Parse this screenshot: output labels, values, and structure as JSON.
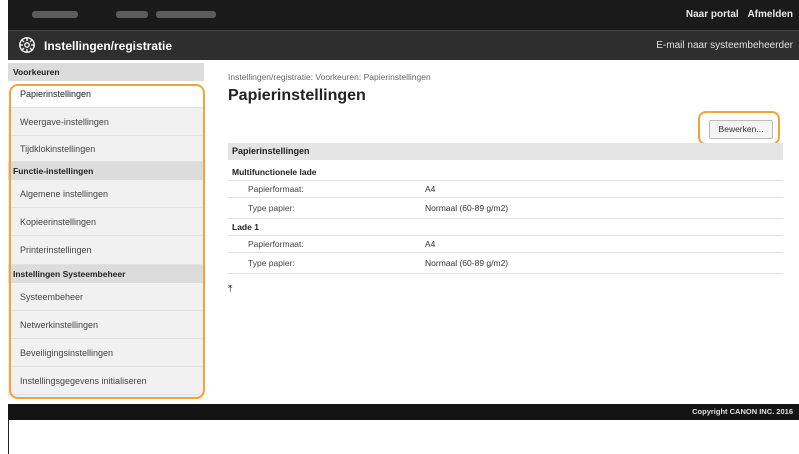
{
  "header": {
    "links": [
      "Naar portal",
      "Afmelden"
    ],
    "title": "Instellingen/registratie",
    "admin_mail": "E-mail naar systeembeheerder"
  },
  "sidebar": {
    "sections": [
      {
        "label": "Voorkeuren",
        "items": [
          "Papierinstellingen",
          "Weergave-instellingen",
          "Tijdklokinstellingen"
        ]
      },
      {
        "label": "Functie-instellingen",
        "items": [
          "Algemene instellingen",
          "Kopieerinstellingen",
          "Printerinstellingen"
        ]
      },
      {
        "label": "Instellingen Systeembeheer",
        "items": [
          "Systeembeheer",
          "Netwerkinstellingen",
          "Beveiligingsinstellingen",
          "Instellingsgegevens initialiseren"
        ]
      }
    ],
    "active_item": "Papierinstellingen"
  },
  "main": {
    "breadcrumb": "Instellingen/registratie: Voorkeuren: Papierinstellingen",
    "title": "Papierinstellingen",
    "edit_button": "Bewerken...",
    "section_title": "Papierinstellingen",
    "groups": [
      {
        "title": "Multifunctionele lade",
        "rows": [
          {
            "label": "Papierformaat:",
            "value": "A4"
          },
          {
            "label": "Type papier:",
            "value": "Normaal (60-89 g/m2)"
          }
        ]
      },
      {
        "title": "Lade 1",
        "rows": [
          {
            "label": "Papierformaat:",
            "value": "A4"
          },
          {
            "label": "Type papier:",
            "value": "Normaal (60-89 g/m2)"
          }
        ]
      }
    ],
    "top_icon": "⤒"
  },
  "footer": {
    "copyright": "Copyright CANON INC. 2016"
  },
  "colors": {
    "highlight": "#f2a43a",
    "topbar": "#1a1a1a",
    "titlebar": "#2e2e2e"
  }
}
